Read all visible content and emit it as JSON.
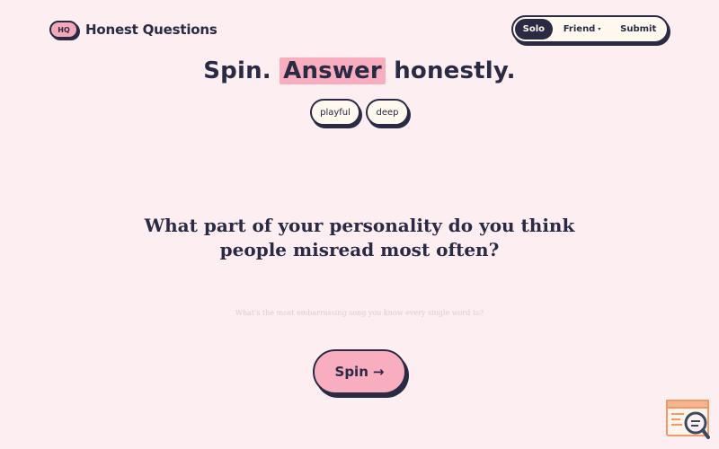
{
  "logo": {
    "badge": "HQ",
    "name": "Honest Questions"
  },
  "nav": {
    "modes": [
      {
        "label": "Solo",
        "active": true
      },
      {
        "label": "Friend",
        "active": false,
        "has_caret": true,
        "caret": "▾"
      },
      {
        "label": "Submit",
        "active": false
      }
    ]
  },
  "headline": {
    "part1": "Spin.",
    "highlight": "Answer",
    "part2": "honestly."
  },
  "chips": [
    {
      "label": "playful"
    },
    {
      "label": "deep"
    }
  ],
  "question": {
    "text": "What part of your personality do you think people misread most often?"
  },
  "answer": {
    "placeholder": "What's the most embarrassing song you know every single word to?"
  },
  "spin_button": {
    "label": "Spin",
    "arrow": "→"
  },
  "colors": {
    "background": "#fdeef1",
    "ink": "#2b2a45",
    "accent_pink": "#f8aebf",
    "cream": "#fff8ee"
  },
  "icons": {
    "help_widget": "search-document-icon"
  }
}
